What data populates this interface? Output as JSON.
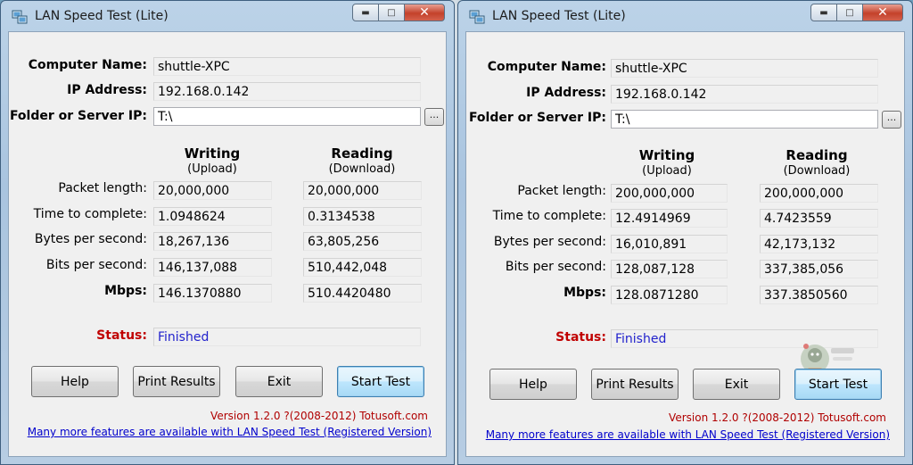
{
  "windows": [
    {
      "title": "LAN Speed Test (Lite)",
      "computer_name_label": "Computer Name:",
      "computer_name": "shuttle-XPC",
      "ip_label": "IP Address:",
      "ip": "192.168.0.142",
      "folder_label": "Folder or Server IP:",
      "folder": "T:\\",
      "browse_label": "...",
      "writing": {
        "title": "Writing",
        "sub": "(Upload)"
      },
      "reading": {
        "title": "Reading",
        "sub": "(Download)"
      },
      "rows": [
        {
          "label": "Packet length:",
          "write": "20,000,000",
          "read": "20,000,000"
        },
        {
          "label": "Time to complete:",
          "write": "1.0948624",
          "read": "0.3134538"
        },
        {
          "label": "Bytes per second:",
          "write": "18,267,136",
          "read": "63,805,256"
        },
        {
          "label": "Bits per second:",
          "write": "146,137,088",
          "read": "510,442,048"
        },
        {
          "label": "Mbps:",
          "write": "146.1370880",
          "read": "510.4420480"
        }
      ],
      "status_label": "Status:",
      "status": "Finished",
      "buttons": {
        "help": "Help",
        "print": "Print Results",
        "exit": "Exit",
        "start": "Start Test"
      },
      "version": "Version 1.2.0  ?(2008-2012) Totusoft.com",
      "link": "Many more features are available with LAN Speed Test (Registered Version)"
    },
    {
      "title": "LAN Speed Test (Lite)",
      "computer_name_label": "Computer Name:",
      "computer_name": "shuttle-XPC",
      "ip_label": "IP Address:",
      "ip": "192.168.0.142",
      "folder_label": "Folder or Server IP:",
      "folder": "T:\\",
      "browse_label": "...",
      "writing": {
        "title": "Writing",
        "sub": "(Upload)"
      },
      "reading": {
        "title": "Reading",
        "sub": "(Download)"
      },
      "rows": [
        {
          "label": "Packet length:",
          "write": "200,000,000",
          "read": "200,000,000"
        },
        {
          "label": "Time to complete:",
          "write": "12.4914969",
          "read": "4.7423559"
        },
        {
          "label": "Bytes per second:",
          "write": "16,010,891",
          "read": "42,173,132"
        },
        {
          "label": "Bits per second:",
          "write": "128,087,128",
          "read": "337,385,056"
        },
        {
          "label": "Mbps:",
          "write": "128.0871280",
          "read": "337.3850560"
        }
      ],
      "status_label": "Status:",
      "status": "Finished",
      "buttons": {
        "help": "Help",
        "print": "Print Results",
        "exit": "Exit",
        "start": "Start Test"
      },
      "version": "Version 1.2.0  ?(2008-2012) Totusoft.com",
      "link": "Many more features are available with LAN Speed Test (Registered Version)"
    }
  ],
  "colors": {
    "status_text": "#2222cc",
    "status_label": "#c00000",
    "version_text": "#b00000",
    "link": "#0000cc"
  }
}
